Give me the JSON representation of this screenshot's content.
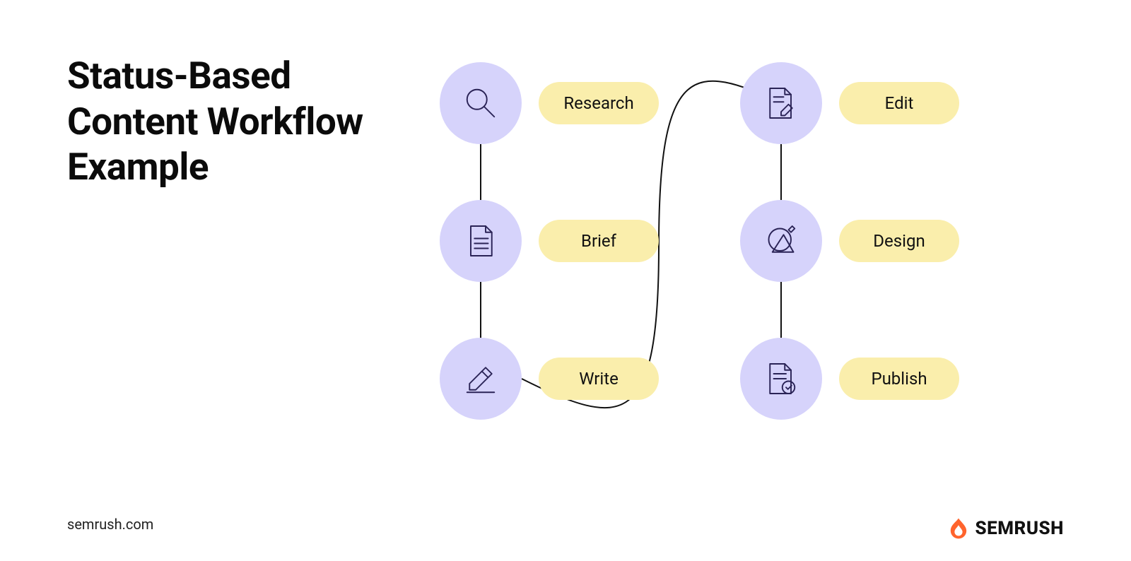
{
  "title": "Status-Based\nContent Workflow\nExample",
  "footer": "semrush.com",
  "brand": "SEMRUSH",
  "steps": {
    "research": "Research",
    "brief": "Brief",
    "write": "Write",
    "edit": "Edit",
    "design": "Design",
    "publish": "Publish"
  },
  "colors": {
    "circle": "#d6d3fb",
    "pill": "#faeeac",
    "brand": "#ff642d"
  }
}
